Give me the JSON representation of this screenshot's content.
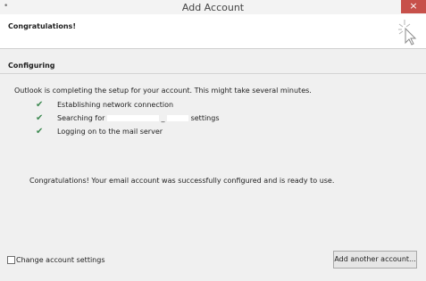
{
  "window": {
    "title": "Add Account",
    "system_menu_glyph": "•",
    "close_glyph": "×"
  },
  "banner": {
    "heading": "Congratulations!",
    "icon": "wizard-sparkle-cursor-icon"
  },
  "section": {
    "title": "Configuring",
    "status_text": "Outlook is completing the setup for your account. This might take several minutes."
  },
  "steps": [
    {
      "check": "✔",
      "label": "Establishing network connection"
    },
    {
      "check": "✔",
      "label_before": "Searching for",
      "label_mid": "_",
      "label_after": "settings"
    },
    {
      "check": "✔",
      "label": "Logging on to the mail server"
    }
  ],
  "success_message": "Congratulations! Your email account was successfully configured and is ready to use.",
  "footer": {
    "checkbox_label": "Change account settings",
    "checkbox_checked": false,
    "add_button_label": "Add another account..."
  },
  "colors": {
    "check_green": "#3e8a52",
    "close_red": "#c7504a"
  }
}
